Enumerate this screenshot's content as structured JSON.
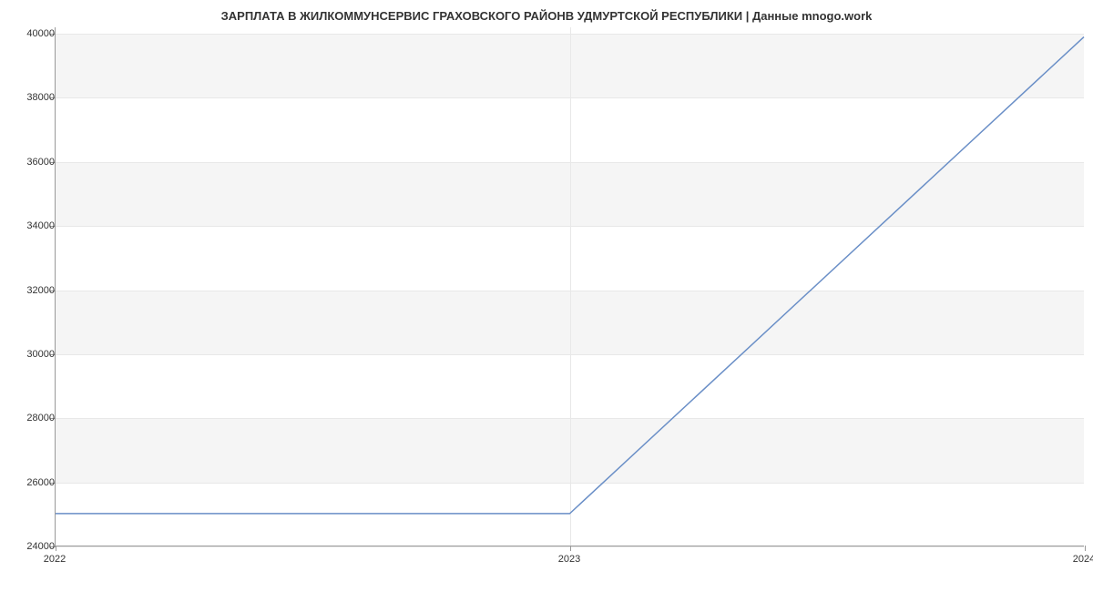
{
  "chart_data": {
    "type": "line",
    "title": "ЗАРПЛАТА В ЖИЛКОММУНСЕРВИС ГРАХОВСКОГО РАЙОНВ УДМУРТСКОЙ РЕСПУБЛИКИ | Данные mnogo.work",
    "x": [
      2022,
      2023,
      2024
    ],
    "y": [
      25000,
      25000,
      39900
    ],
    "xlabel": "",
    "ylabel": "",
    "x_ticks": [
      "2022",
      "2023",
      "2024"
    ],
    "y_ticks": [
      24000,
      26000,
      28000,
      30000,
      32000,
      34000,
      36000,
      38000,
      40000
    ],
    "ylim": [
      24000,
      40200
    ],
    "xlim": [
      2022,
      2024
    ],
    "line_color": "#6a8fc7"
  }
}
